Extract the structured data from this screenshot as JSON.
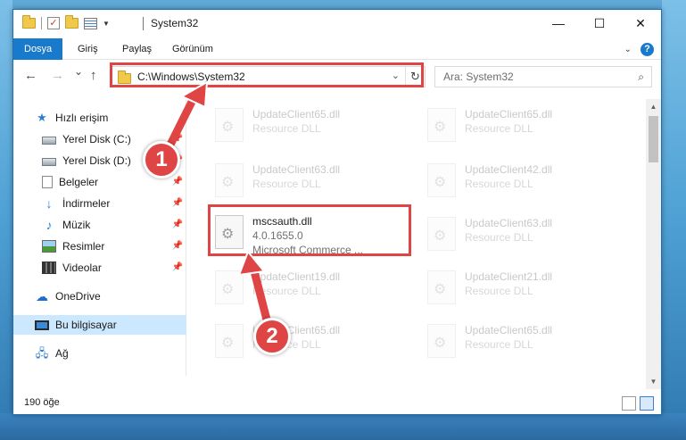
{
  "window": {
    "title": "System32",
    "controls": {
      "minimize": "—",
      "maximize": "☐",
      "close": "✕"
    }
  },
  "ribbon": {
    "tabs": [
      "Dosya",
      "Giriş",
      "Paylaş",
      "Görünüm"
    ],
    "active_tab": "Dosya",
    "help": "?"
  },
  "navigation": {
    "back": "←",
    "forward": "→",
    "recent": "⌄",
    "up": "↑",
    "address_path": "C:\\Windows\\System32",
    "refresh": "↻",
    "search_placeholder": "Ara: System32"
  },
  "sidebar": {
    "items": [
      {
        "label": "Hızlı erişim",
        "icon": "star-icon"
      },
      {
        "label": "Yerel Disk (C:)",
        "icon": "disk-icon",
        "pinned": true
      },
      {
        "label": "Yerel Disk (D:)",
        "icon": "disk-icon",
        "pinned": true
      },
      {
        "label": "Belgeler",
        "icon": "documents-icon",
        "pinned": true
      },
      {
        "label": "İndirmeler",
        "icon": "download-icon",
        "pinned": true
      },
      {
        "label": "Müzik",
        "icon": "music-icon",
        "pinned": true
      },
      {
        "label": "Resimler",
        "icon": "pictures-icon",
        "pinned": true
      },
      {
        "label": "Videolar",
        "icon": "videos-icon",
        "pinned": true
      },
      {
        "label": "OneDrive",
        "icon": "onedrive-icon"
      },
      {
        "label": "Bu bilgisayar",
        "icon": "computer-icon",
        "selected": true
      },
      {
        "label": "Ağ",
        "icon": "network-icon"
      }
    ]
  },
  "files": [
    {
      "name": "UpdateClient65.dll",
      "desc": "Resource DLL"
    },
    {
      "name": "UpdateClient65.dll",
      "desc": "Resource DLL"
    },
    {
      "name": "UpdateClient63.dll",
      "desc": "Resource DLL"
    },
    {
      "name": "UpdateClient42.dll",
      "desc": "Resource DLL"
    },
    {
      "name": "mscsauth.dll",
      "desc": "4.0.1655.0",
      "desc2": "Microsoft Commerce ...",
      "highlighted": true
    },
    {
      "name": "UpdateClient63.dll",
      "desc": "Resource DLL"
    },
    {
      "name": "UpdateClient19.dll",
      "desc": "Resource DLL"
    },
    {
      "name": "UpdateClient21.dll",
      "desc": "Resource DLL"
    },
    {
      "name": "UpdateClient65.dll",
      "desc": "Resource DLL"
    },
    {
      "name": "UpdateClient65.dll",
      "desc": "Resource DLL"
    }
  ],
  "status": {
    "item_count": "190 öğe"
  },
  "annotations": {
    "step1": "1",
    "step2": "2",
    "color": "#e04545"
  }
}
